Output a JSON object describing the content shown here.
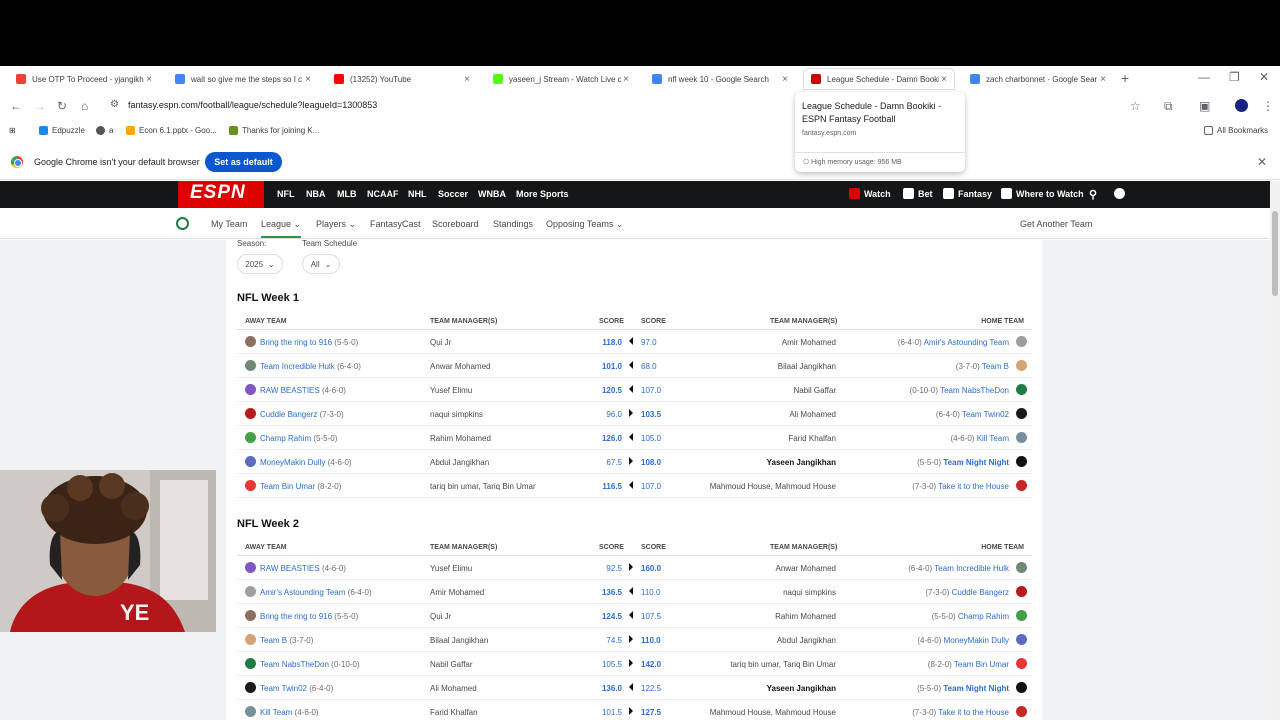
{
  "browser": {
    "tabs": [
      {
        "title": "Use OTP To Proceed - yjangikh",
        "icon": "gmail-icon",
        "color": "#ea4335"
      },
      {
        "title": "wait so give me the steps so I c",
        "icon": "google-icon",
        "color": "#4285f4"
      },
      {
        "title": "(13252) YouTube",
        "icon": "youtube-icon",
        "color": "#ff0000"
      },
      {
        "title": "yaseen_j Stream - Watch Live o",
        "icon": "kick-icon",
        "color": "#53fc18"
      },
      {
        "title": "nfl week 10 - Google Search",
        "icon": "google-icon",
        "color": "#4285f4"
      },
      {
        "title": "League Schedule - Damn Booki",
        "icon": "espn-icon",
        "color": "#cc0000"
      },
      {
        "title": "zach charbonnet - Google Sear",
        "icon": "google-icon",
        "color": "#4285f4"
      }
    ],
    "url": "fantasy.espn.com/football/league/schedule?leagueId=1300853",
    "bookmarks": [
      {
        "label": "Edpuzzle",
        "color": "#1e88e5"
      },
      {
        "label": "a",
        "color": "#555555"
      },
      {
        "label": "Econ 6.1.pptx - Goo...",
        "color": "#f9ab00"
      },
      {
        "label": "Thanks for joining K...",
        "color": "#6b8e23"
      }
    ],
    "all_bookmarks": "All Bookmarks",
    "infobar_text": "Google Chrome isn't your default browser",
    "set_default": "Set as default",
    "hover_card": {
      "title": "League Schedule - Damn Bookiki - ESPN Fantasy Football",
      "host": "fantasy.espn.com",
      "memory": "High memory usage: 956 MB"
    }
  },
  "espn": {
    "logo": "ESPN",
    "nav": [
      "NFL",
      "NBA",
      "MLB",
      "NCAAF",
      "NHL",
      "Soccer",
      "WNBA",
      "More Sports"
    ],
    "nav_right": [
      "Watch",
      "Bet",
      "Fantasy",
      "Where to Watch"
    ],
    "subnav": [
      "My Team",
      "League",
      "Players",
      "FantasyCast",
      "Scoreboard",
      "Standings",
      "Opposing Teams"
    ],
    "get_another_team": "Get Another Team"
  },
  "filters": {
    "season_label": "Season:",
    "season_value": "2025",
    "team_label": "Team Schedule",
    "team_value": "All"
  },
  "table_headers": {
    "away_team": "AWAY TEAM",
    "managers": "TEAM MANAGER(S)",
    "score": "SCORE",
    "home_team": "HOME TEAM"
  },
  "weeks": [
    {
      "title": "NFL Week 1",
      "games": [
        {
          "away": "Bring the ring to 916",
          "away_rec": "(5-5-0)",
          "away_mgr": "Qui Jr",
          "away_score": "118.0",
          "home_score": "97.0",
          "home_mgr": "Amir Mohamed",
          "home_rec": "(6-4-0)",
          "home": "Amir's Astounding Team",
          "winner": "away",
          "away_color": "#8d6e63",
          "home_color": "#9e9e9e"
        },
        {
          "away": "Team Incredible Hulk",
          "away_rec": "(6-4-0)",
          "away_mgr": "Anwar Mohamed",
          "away_score": "101.0",
          "home_score": "68.0",
          "home_mgr": "Bilaal Jangikhan",
          "home_rec": "(3-7-0)",
          "home": "Team B",
          "winner": "away",
          "away_color": "#6d8b74",
          "home_color": "#d4a373"
        },
        {
          "away": "RAW BEASTIES",
          "away_rec": "(4-6-0)",
          "away_mgr": "Yusef Elimu",
          "away_score": "120.5",
          "home_score": "107.0",
          "home_mgr": "Nabil Gaffar",
          "home_rec": "(0-10-0)",
          "home": "Team NabsTheDon",
          "winner": "away",
          "away_color": "#7e57c2",
          "home_color": "#1e7d46"
        },
        {
          "away": "Cuddle Bangerz",
          "away_rec": "(7-3-0)",
          "away_mgr": "naqui simpkins",
          "away_score": "96.0",
          "home_score": "103.5",
          "home_mgr": "Ali Mohamed",
          "home_rec": "(6-4-0)",
          "home": "Team Twin02",
          "winner": "home",
          "away_color": "#b71c1c",
          "home_color": "#1a1a1a"
        },
        {
          "away": "Champ Rahim",
          "away_rec": "(5-5-0)",
          "away_mgr": "Rahim Mohamed",
          "away_score": "126.0",
          "home_score": "105.0",
          "home_mgr": "Farid Khalfan",
          "home_rec": "(4-6-0)",
          "home": "Kill Team",
          "winner": "away",
          "away_color": "#43a047",
          "home_color": "#78909c"
        },
        {
          "away": "MoneyMakin Dully",
          "away_rec": "(4-6-0)",
          "away_mgr": "Abdul Jangikhan",
          "away_score": "67.5",
          "home_score": "108.0",
          "home_mgr": "Yaseen Jangikhan",
          "home_rec": "(5-5-0)",
          "home": "Team Night Night",
          "winner": "home",
          "home_bold": true,
          "away_color": "#5c6bc0",
          "home_color": "#111111"
        },
        {
          "away": "Team Bin Umar",
          "away_rec": "(8-2-0)",
          "away_mgr": "tariq bin umar, Tariq Bin Umar",
          "away_score": "116.5",
          "home_score": "107.0",
          "home_mgr": "Mahmoud House, Mahmoud House",
          "home_rec": "(7-3-0)",
          "home": "Take it to the House",
          "winner": "away",
          "away_color": "#e53935",
          "home_color": "#c62828"
        }
      ]
    },
    {
      "title": "NFL Week 2",
      "games": [
        {
          "away": "RAW BEASTIES",
          "away_rec": "(4-6-0)",
          "away_mgr": "Yusef Elimu",
          "away_score": "92.5",
          "home_score": "160.0",
          "home_mgr": "Anwar Mohamed",
          "home_rec": "(6-4-0)",
          "home": "Team Incredible Hulk",
          "winner": "home",
          "away_color": "#7e57c2",
          "home_color": "#6d8b74"
        },
        {
          "away": "Amir's Astounding Team",
          "away_rec": "(6-4-0)",
          "away_mgr": "Amir Mohamed",
          "away_score": "136.5",
          "home_score": "110.0",
          "home_mgr": "naqui simpkins",
          "home_rec": "(7-3-0)",
          "home": "Cuddle Bangerz",
          "winner": "away",
          "away_color": "#9e9e9e",
          "home_color": "#b71c1c"
        },
        {
          "away": "Bring the ring to 916",
          "away_rec": "(5-5-0)",
          "away_mgr": "Qui Jr",
          "away_score": "124.5",
          "home_score": "107.5",
          "home_mgr": "Rahim Mohamed",
          "home_rec": "(5-5-0)",
          "home": "Champ Rahim",
          "winner": "away",
          "away_color": "#8d6e63",
          "home_color": "#43a047"
        },
        {
          "away": "Team B",
          "away_rec": "(3-7-0)",
          "away_mgr": "Bilaal Jangikhan",
          "away_score": "74.5",
          "home_score": "110.0",
          "home_mgr": "Abdul Jangikhan",
          "home_rec": "(4-6-0)",
          "home": "MoneyMakin Dully",
          "winner": "home",
          "away_color": "#d4a373",
          "home_color": "#5c6bc0"
        },
        {
          "away": "Team NabsTheDon",
          "away_rec": "(0-10-0)",
          "away_mgr": "Nabil Gaffar",
          "away_score": "105.5",
          "home_score": "142.0",
          "home_mgr": "tariq bin umar, Tariq Bin Umar",
          "home_rec": "(8-2-0)",
          "home": "Team Bin Umar",
          "winner": "home",
          "away_color": "#1e7d46",
          "home_color": "#e53935"
        },
        {
          "away": "Team Twin02",
          "away_rec": "(6-4-0)",
          "away_mgr": "Ali Mohamed",
          "away_score": "136.0",
          "home_score": "122.5",
          "home_mgr": "Yaseen Jangikhan",
          "home_rec": "(5-5-0)",
          "home": "Team Night Night",
          "winner": "away",
          "home_bold": true,
          "away_color": "#1a1a1a",
          "home_color": "#111111"
        },
        {
          "away": "Kill Team",
          "away_rec": "(4-6-0)",
          "away_mgr": "Farid Khalfan",
          "away_score": "101.5",
          "home_score": "127.5",
          "home_mgr": "Mahmoud House, Mahmoud House",
          "home_rec": "(7-3-0)",
          "home": "Take it to the House",
          "winner": "home",
          "away_color": "#78909c",
          "home_color": "#c62828"
        }
      ]
    }
  ]
}
